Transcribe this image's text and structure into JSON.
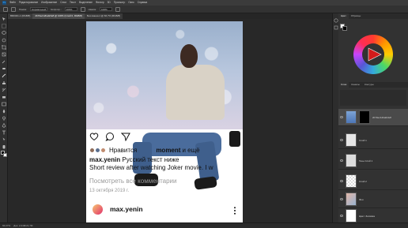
{
  "menubar": {
    "logo": "Ps",
    "items": [
      "Файл",
      "Редактирование",
      "Изображение",
      "Слои",
      "Текст",
      "Выделение",
      "Фильтр",
      "3D",
      "Просмотр",
      "Окно",
      "Справка"
    ]
  },
  "options": {
    "mode_label": "Режим:",
    "mode_value": "Нормальный",
    "opacity_label": "Непрозр.:",
    "opacity_value": "100%",
    "flow_label": "Нажим:",
    "flow_value": "100%"
  },
  "tabs": [
    {
      "label": "BR0321-1 (RGB/8)",
      "active": false
    },
    {
      "label": "2b70ec12ba0cfe8 @ 100% (Слой 0, RGB/8)",
      "active": true
    },
    {
      "label": "Без имени-1 @ 66,7% (RGB/8)",
      "active": false
    }
  ],
  "instagram": {
    "likes_prefix": "Нравится",
    "likes_name": "moment",
    "likes_suffix": "и ещё",
    "caption_user": "max.yenin",
    "caption_text": "Русский текст ниже",
    "caption_line2": "Short review after watching Joker movie. I w",
    "comments": "Посмотреть все комментарии",
    "date": "13 октября 2019 г.",
    "username": "max.yenin",
    "colors": {
      "text": "#111111",
      "muted": "#9a9a9a"
    }
  },
  "panels": {
    "color_tabs": [
      "Цвет",
      "Образцы"
    ],
    "layer_tabs": [
      "Слои",
      "Каналы",
      "Контуры"
    ],
    "layers": [
      {
        "name": "2b70ec12ba0cfe8",
        "selected": true,
        "thumb": "sky"
      },
      {
        "name": "Слой 1",
        "selected": false,
        "thumb": "person"
      },
      {
        "name": "Тень Слой 1",
        "selected": false,
        "thumb": "shadow"
      },
      {
        "name": "Слой 2",
        "selected": false,
        "thumb": "checker"
      },
      {
        "name": "Фон",
        "selected": false,
        "thumb": "bokeh"
      },
      {
        "name": "Цвет: Заливка",
        "selected": false,
        "thumb": "white"
      }
    ]
  },
  "status": {
    "zoom": "66,67%",
    "doc_size": "Док: 2,64M/21,7M"
  },
  "accent": "#31a8ff"
}
